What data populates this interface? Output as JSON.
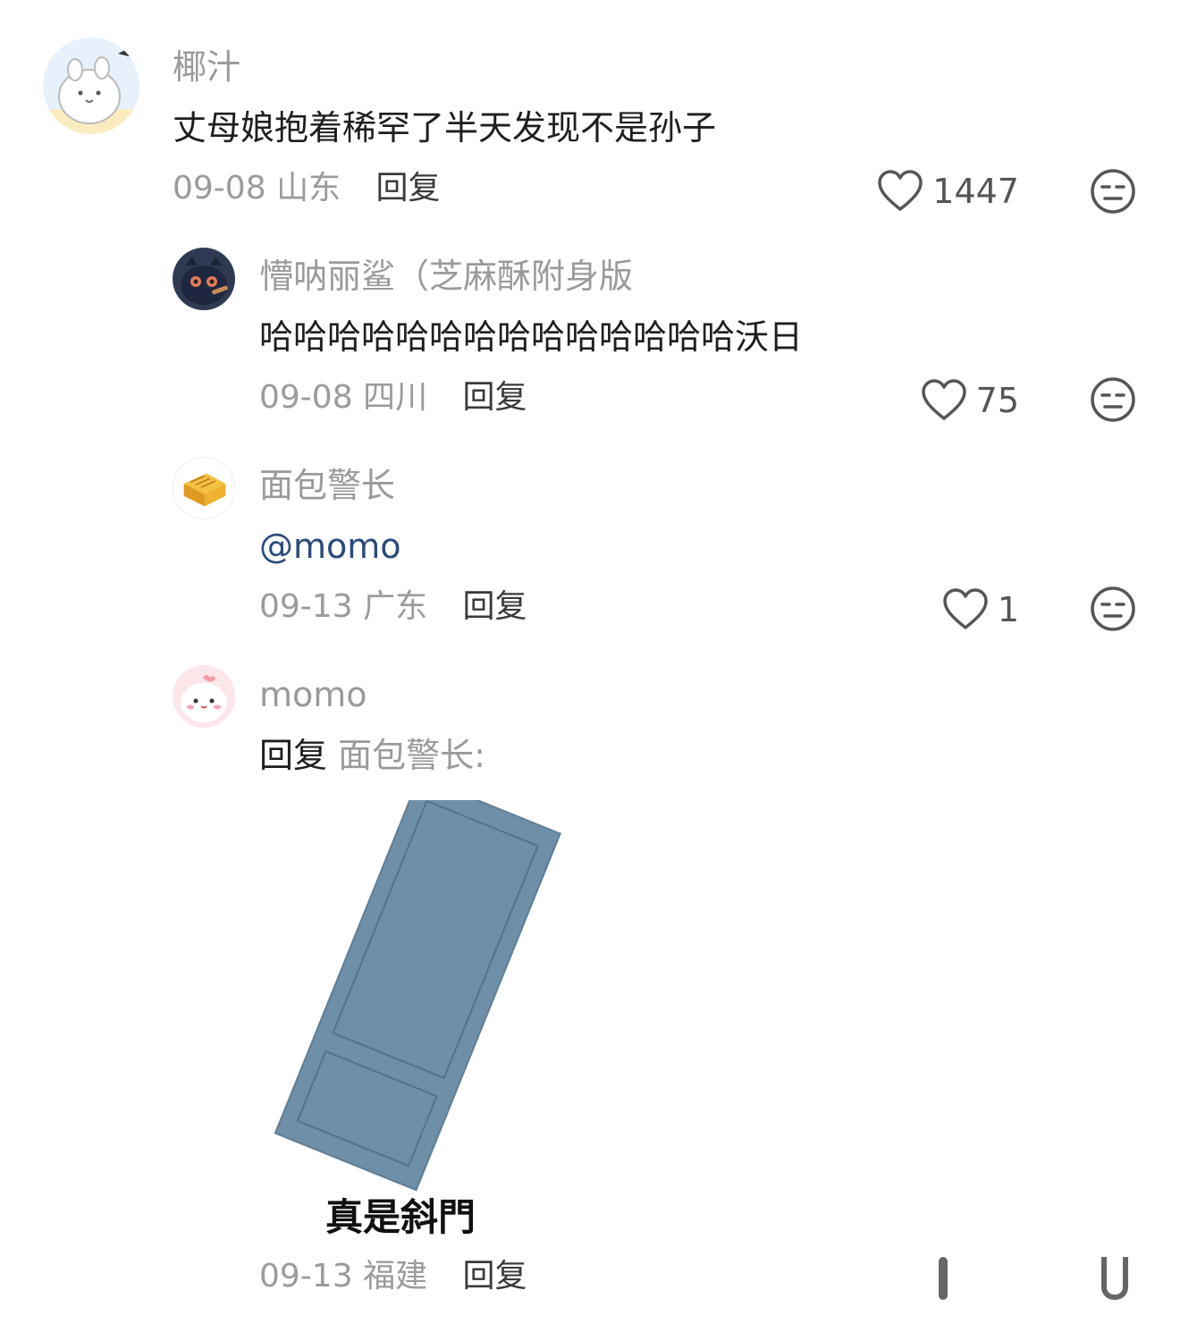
{
  "comments": [
    {
      "username": "椰汁",
      "text": "丈母娘抱着稀罕了半天发现不是孙子",
      "date": "09-08",
      "location": "山东",
      "reply_label": "回复",
      "likes": "1447"
    },
    {
      "username": "懵呐丽鲨（芝麻酥附身版",
      "text": "哈哈哈哈哈哈哈哈哈哈哈哈哈哈沃日",
      "date": "09-08",
      "location": "四川",
      "reply_label": "回复",
      "likes": "75"
    },
    {
      "username": "面包警长",
      "text": "@momo",
      "date": "09-13",
      "location": "广东",
      "reply_label": "回复",
      "likes": "1"
    },
    {
      "username": "momo",
      "reply_word": "回复",
      "reply_target": "面包警长:",
      "image_caption": "真是斜門",
      "date": "09-13",
      "location": "福建",
      "reply_label": "回复"
    }
  ],
  "icons": {
    "like": "heart-outline-icon",
    "dislike": "unamused-face-icon"
  },
  "colors": {
    "door": "#6f8fa8",
    "mention": "#2a4a7a"
  }
}
